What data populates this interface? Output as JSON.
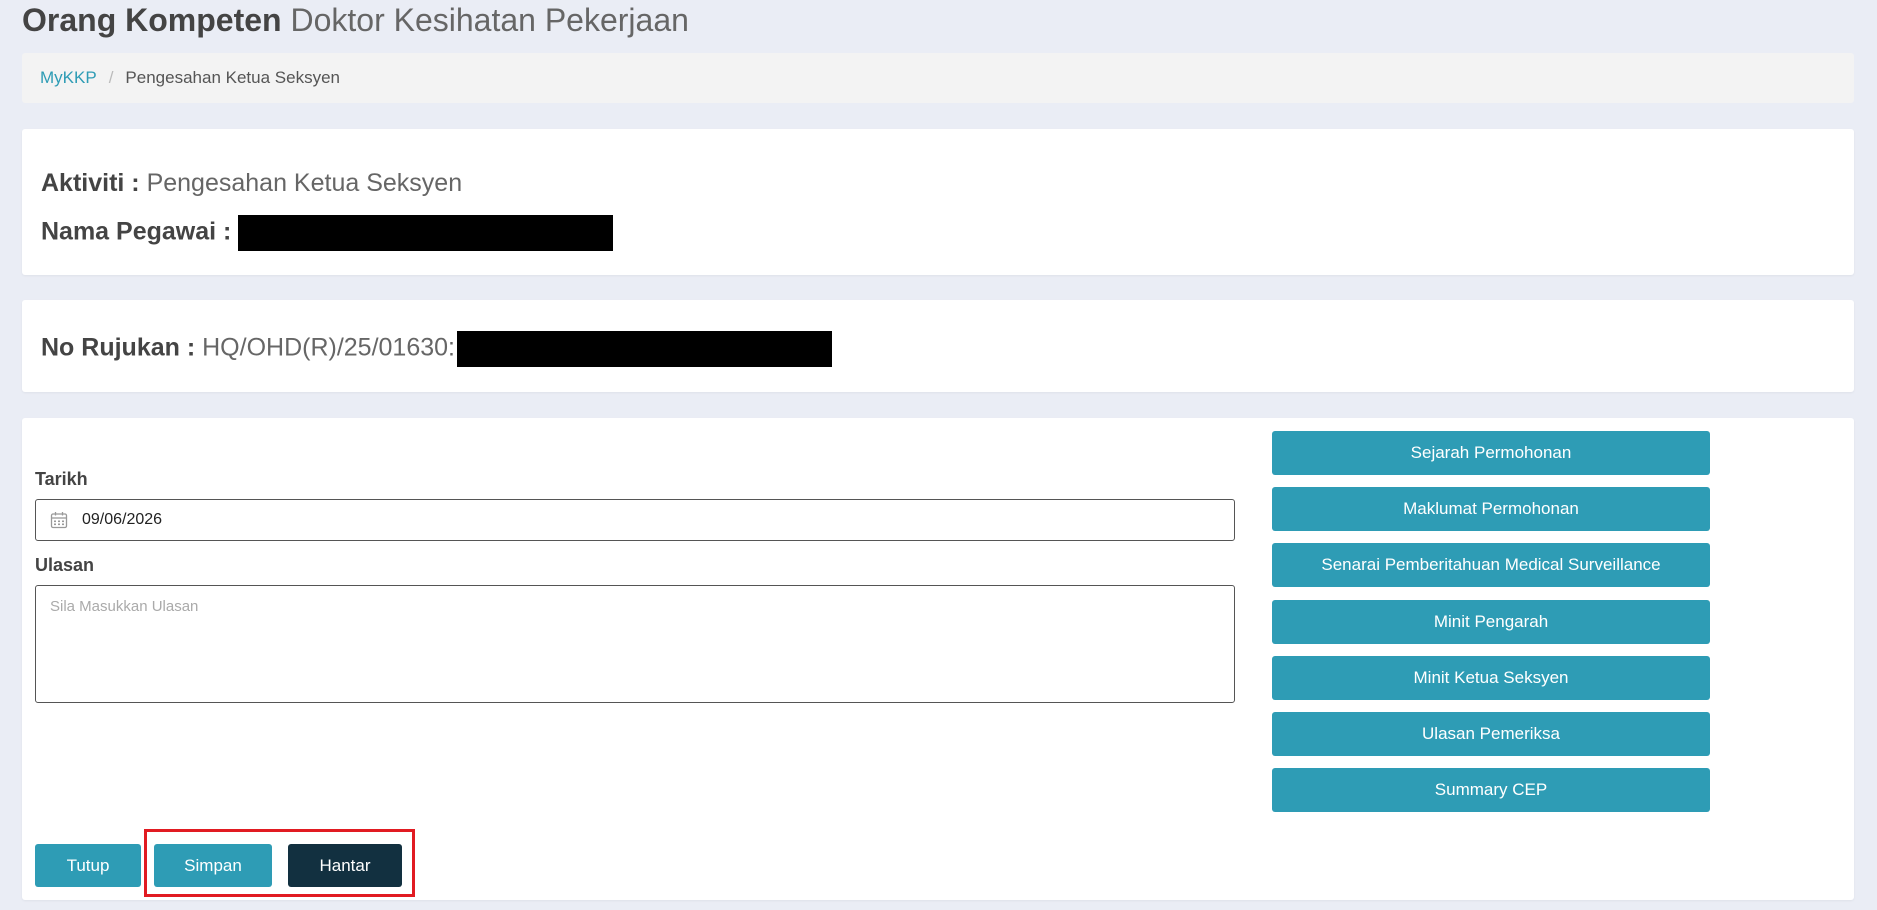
{
  "header": {
    "title_bold": "Orang Kompeten",
    "title_light": "Doktor Kesihatan Pekerjaan"
  },
  "breadcrumb": {
    "home": "MyKKP",
    "separator": "/",
    "current": "Pengesahan Ketua Seksyen"
  },
  "info": {
    "aktiviti_label": "Aktiviti :",
    "aktiviti_value": "Pengesahan Ketua Seksyen",
    "nama_label": "Nama Pegawai :",
    "rujukan_label": "No Rujukan :",
    "rujukan_value": "HQ/OHD(R)/25/01630:"
  },
  "form": {
    "tarikh_label": "Tarikh",
    "tarikh_value": "09/06/2026",
    "ulasan_label": "Ulasan",
    "ulasan_placeholder": "Sila Masukkan Ulasan"
  },
  "side_buttons": [
    "Sejarah Permohonan",
    "Maklumat Permohonan",
    "Senarai Pemberitahuan Medical Surveillance",
    "Minit Pengarah",
    "Minit Ketua Seksyen",
    "Ulasan Pemeriksa",
    "Summary CEP"
  ],
  "actions": {
    "tutup": "Tutup",
    "simpan": "Simpan",
    "hantar": "Hantar"
  },
  "colors": {
    "primary": "#2e9cb5",
    "dark": "#123040",
    "highlight": "#e11b22",
    "background": "#eaedf5"
  }
}
